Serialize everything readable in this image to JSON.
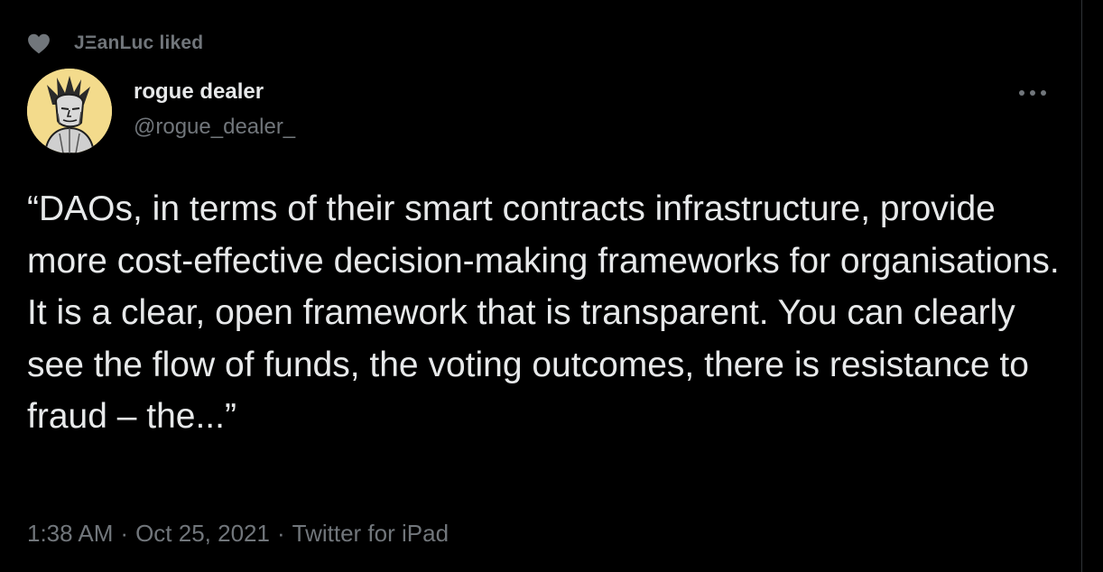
{
  "social_context": {
    "icon": "heart-icon",
    "text": "JΞanLuc liked"
  },
  "author": {
    "display_name": "rogue dealer",
    "handle": "@rogue_dealer_"
  },
  "more_menu": {
    "icon": "more-horizontal-icon"
  },
  "tweet": {
    "text": "“DAOs, in terms of their smart contracts infrastructure, provide more cost-effective decision-making frameworks for organisations. It is a clear, open framework that is transparent. You can clearly see the flow of funds, the voting outcomes, there is resistance to fraud – the...”",
    "time": "1:38 AM",
    "date": "Oct 25, 2021",
    "source": "Twitter for iPad",
    "separator": "·"
  },
  "colors": {
    "background": "#000000",
    "primary_text": "#e7e9ea",
    "secondary_text": "#71767b",
    "avatar_bg": "#f3db8c"
  }
}
